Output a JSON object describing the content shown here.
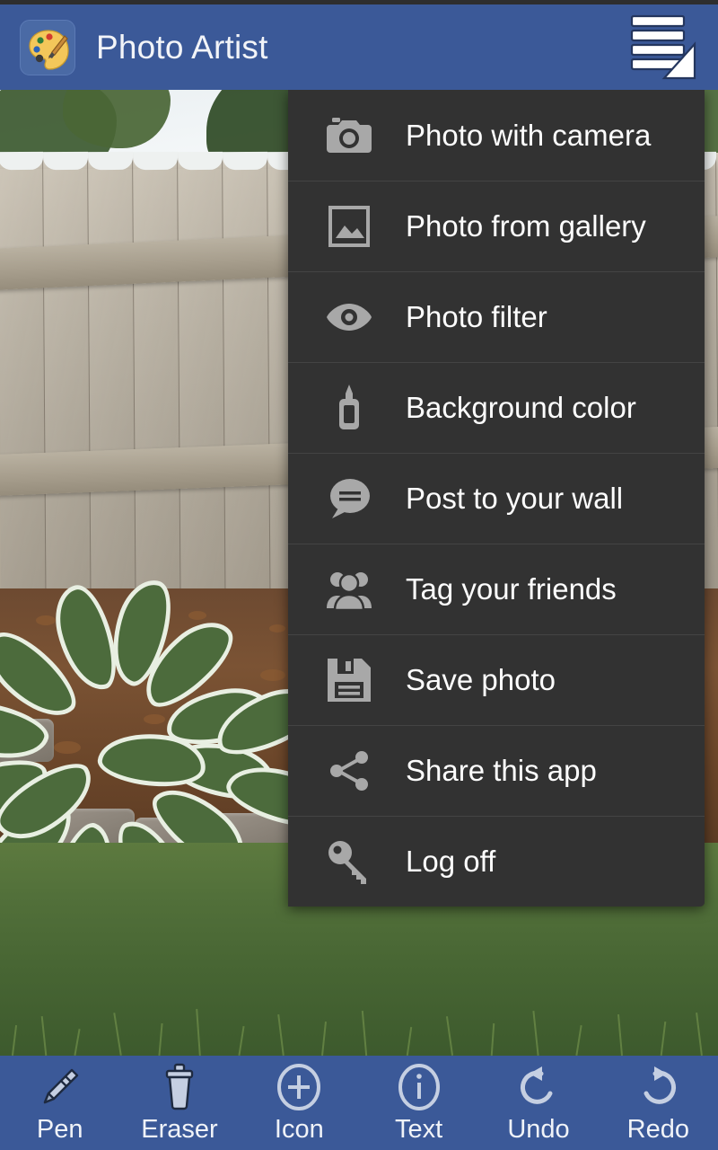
{
  "app": {
    "title": "Photo Artist",
    "icon": "palette-icon",
    "header_color": "#3b5998",
    "menu_panel_color": "#323232"
  },
  "header": {
    "menu_button": "hamburger-menu-icon"
  },
  "canvas": {
    "content": "backyard photo with wooden fence, hosta plant, mulch bed and grass"
  },
  "menu": {
    "items": [
      {
        "label": "Photo with camera",
        "icon": "camera-icon"
      },
      {
        "label": "Photo from gallery",
        "icon": "image-icon"
      },
      {
        "label": "Photo filter",
        "icon": "eye-icon"
      },
      {
        "label": "Background color",
        "icon": "paint-bottle-icon"
      },
      {
        "label": "Post to your wall",
        "icon": "speech-bubble-icon"
      },
      {
        "label": "Tag your friends",
        "icon": "people-icon"
      },
      {
        "label": "Save photo",
        "icon": "floppy-disk-icon"
      },
      {
        "label": "Share this app",
        "icon": "share-icon"
      },
      {
        "label": "Log off",
        "icon": "key-icon"
      }
    ]
  },
  "toolbar": {
    "items": [
      {
        "label": "Pen",
        "icon": "pencil-icon"
      },
      {
        "label": "Eraser",
        "icon": "trash-icon"
      },
      {
        "label": "Icon",
        "icon": "plus-circle-icon"
      },
      {
        "label": "Text",
        "icon": "info-circle-icon"
      },
      {
        "label": "Undo",
        "icon": "undo-arrow-icon"
      },
      {
        "label": "Redo",
        "icon": "redo-arrow-icon"
      }
    ]
  }
}
